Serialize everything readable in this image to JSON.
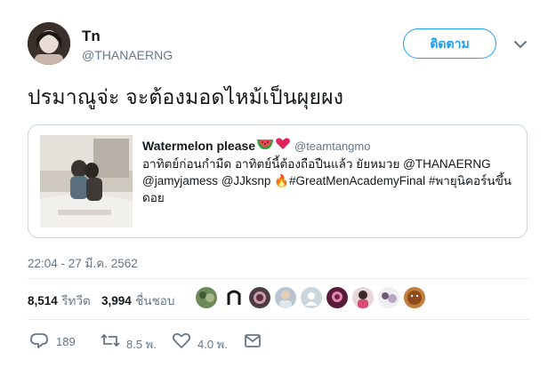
{
  "author": {
    "name": "Tn",
    "handle": "@THANAERNG"
  },
  "follow_label": "ติดตาม",
  "tweet_text": "ปรมาณูจ่ะ จะต้องมอดไหม้เป็นผุยผง",
  "quoted": {
    "name": "Watermelon please",
    "handle": "@teamtangmo",
    "line1": "อาทิตย์ก่อนกำมืด อาทิตย์นี้ต้องถือปืนแล้ว ยัยหมวย @THANAERNG",
    "line2": "@jamyjamess @JJksnp 🔥#GreatMenAcademyFinal #พายุนิคอร์นขึ้น",
    "line3": "ดอย",
    "emojis": [
      "watermelon",
      "red-heart"
    ]
  },
  "timestamp": "22:04 - 27 มี.ค. 2562",
  "stats": {
    "retweets_count": "8,514",
    "retweets_label": "รีทวีต",
    "likes_count": "3,994",
    "likes_label": "ชื่นชอบ"
  },
  "actions": {
    "replies": "189",
    "retweets": "8.5 พ.",
    "likes": "4.0 พ."
  },
  "colors": {
    "accent": "#1da1f2",
    "muted": "#657786",
    "text": "#14171a",
    "border": "#ccd6dd"
  }
}
